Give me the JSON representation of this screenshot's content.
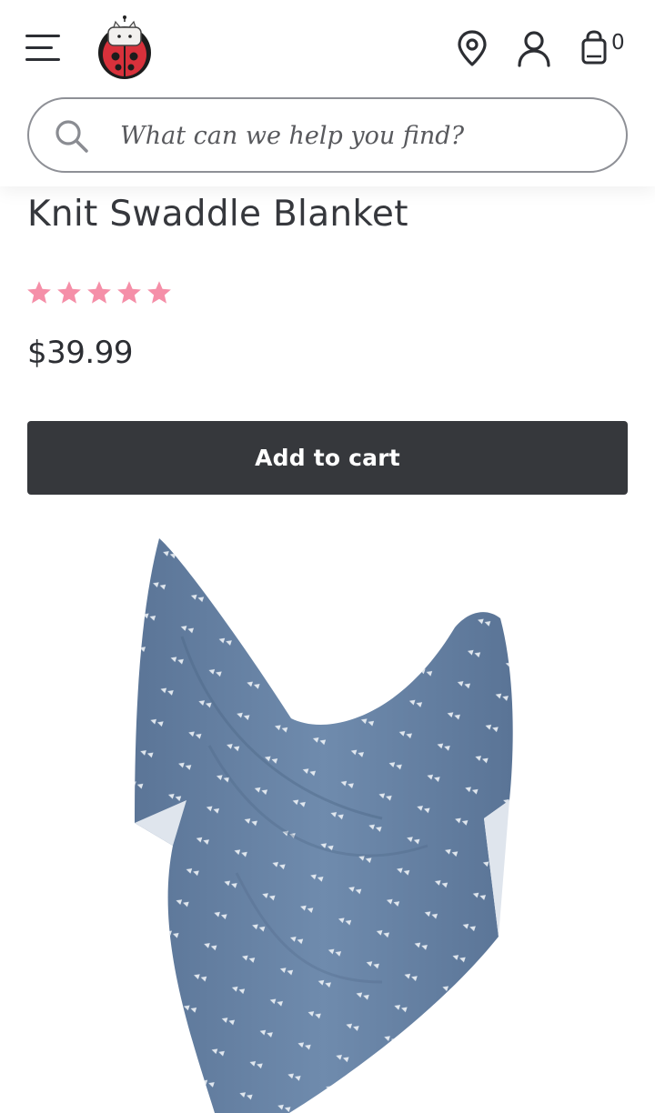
{
  "header": {
    "menu_icon": "hamburger-menu-icon",
    "logo_icon": "ladybug-logo",
    "location_icon": "map-pin-icon",
    "account_icon": "user-icon",
    "cart_icon": "shopping-bag-icon",
    "cart_count": "0"
  },
  "search": {
    "placeholder": "What can we help you find?",
    "value": ""
  },
  "product": {
    "title": "Knit Swaddle Blanket",
    "rating": 5,
    "rating_max": 5,
    "price": "$39.99",
    "add_to_cart_label": "Add to cart",
    "image": "blue knit swaddle blanket with white arrow pattern"
  },
  "colors": {
    "star": "#f58fa8",
    "button": "#36383c",
    "text": "#36383d",
    "blanket": "#6683a6"
  }
}
